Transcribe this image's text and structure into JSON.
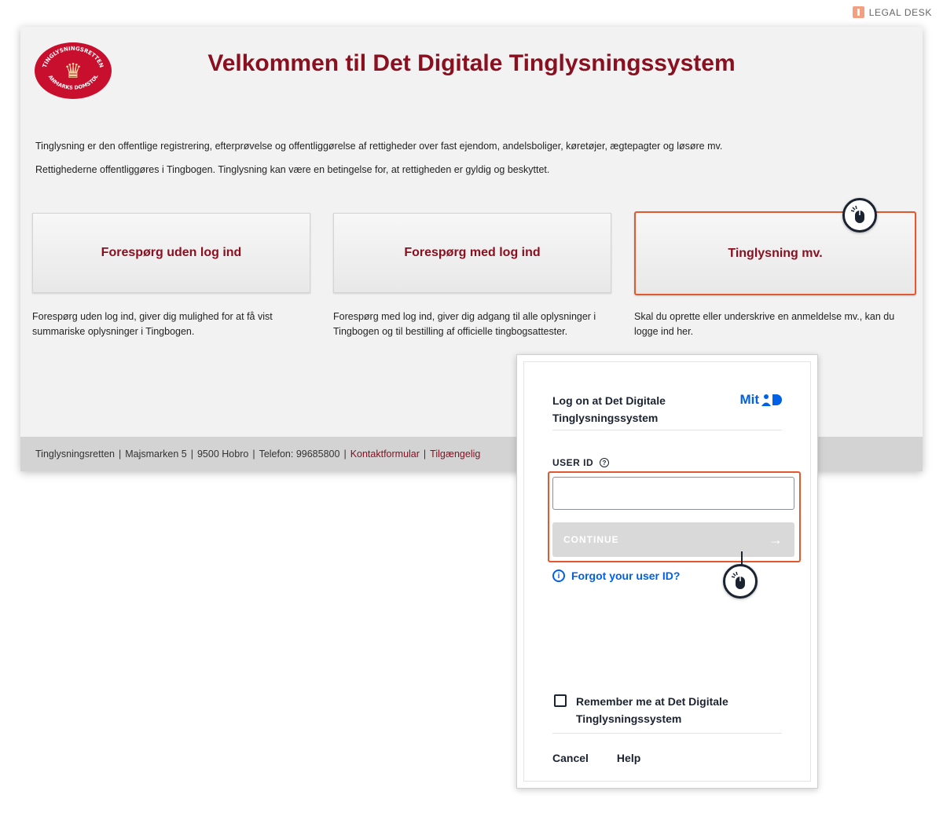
{
  "brand": {
    "label": "LEGAL DESK"
  },
  "header": {
    "title": "Velkommen til Det Digitale Tinglysningssystem",
    "seal_text_top": "TINGLYSNINGSRETTEN",
    "seal_text_bottom": "DANMARKS DOMSTOLE"
  },
  "intro": [
    "Tinglysning er den offentlige registrering, efterprøvelse og offentliggørelse af rettigheder over fast ejendom, andelsboliger, køretøjer, ægtepagter og løsøre mv.",
    "Rettighederne offentliggøres i Tingbogen. Tinglysning kan være en betingelse for, at rettigheden er gyldig og beskyttet."
  ],
  "cards": [
    {
      "label": "Forespørg uden log ind",
      "description": "Forespørg uden log ind, giver dig mulighed for at få vist summariske oplysninger i Tingbogen."
    },
    {
      "label": "Forespørg med log ind",
      "description": "Forespørg med log ind, giver dig adgang til alle oplysninger i Tingbogen og til bestilling af officielle tingbogsattester."
    },
    {
      "label": "Tinglysning mv.",
      "description": "Skal du oprette eller underskrive en anmeldelse mv., kan du logge ind her."
    }
  ],
  "footer": {
    "org": "Tinglysningsretten",
    "address": "Majsmarken 5",
    "city": "9500 Hobro",
    "phone": "Telefon: 99685800",
    "contact_link": "Kontaktformular",
    "accessibility_link": "Tilgængelig"
  },
  "dialog": {
    "title": "Log on at Det Digitale Tinglysningssystem",
    "logo_text": "Mit",
    "userid_label": "USER ID",
    "help_glyph": "?",
    "userid_value": "",
    "continue_label": "CONTINUE",
    "forgot_label": "Forgot your user ID?",
    "remember_label": "Remember me at Det Digitale Tinglysningssystem",
    "cancel_label": "Cancel",
    "help_label": "Help"
  },
  "colors": {
    "accent_red": "#8a1020",
    "highlight": "#e4582f",
    "mitid_blue": "#0060e6"
  },
  "icons": [
    "mouse-cursor-icon",
    "info-icon",
    "help-icon",
    "arrow-right-icon",
    "crown-icon"
  ]
}
